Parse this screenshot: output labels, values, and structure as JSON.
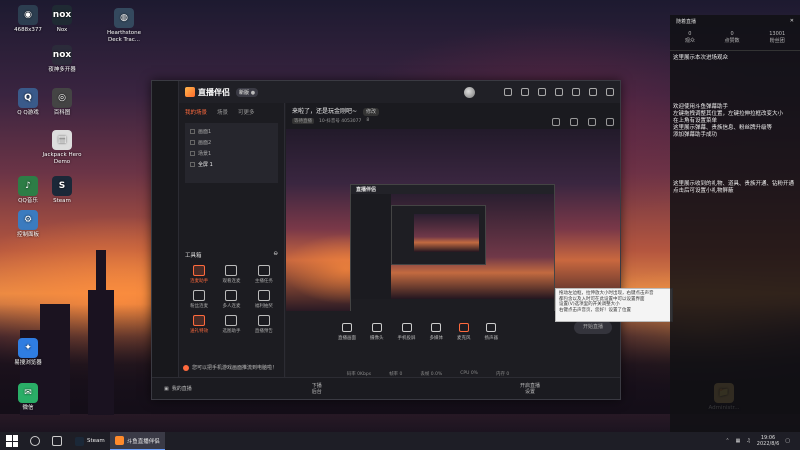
{
  "desktop_icons": [
    {
      "label": "4688x377",
      "color": "#2c3e50",
      "glyph": "◉"
    },
    {
      "label": "Nox",
      "color": "#1f2a33",
      "glyph": "nox"
    },
    {
      "label": "Hearthstone Deck Trac...",
      "color": "#34495e",
      "glyph": "◍"
    },
    {
      "label": "夜神多开器",
      "color": "#2b2b3a",
      "glyph": "nox"
    },
    {
      "label": "Q Q游戏",
      "color": "#3a5a8a",
      "glyph": "Q"
    },
    {
      "label": "百科图",
      "color": "#444",
      "glyph": "◎"
    },
    {
      "label": "Jackpack Hero Demo",
      "color": "#ddd",
      "glyph": "▤"
    },
    {
      "label": "QQ音乐",
      "color": "#2d7d46",
      "glyph": "♪"
    },
    {
      "label": "Steam",
      "color": "#1b2838",
      "glyph": "S"
    },
    {
      "label": "控制面板",
      "color": "#3b7bbf",
      "glyph": "⚙"
    },
    {
      "label": "易搜浏览器",
      "color": "#2f7de1",
      "glyph": "✦"
    },
    {
      "label": "微信",
      "color": "#2aae67",
      "glyph": "✉"
    },
    {
      "label": "Administr...",
      "color": "#e8c26a",
      "glyph": "📁"
    }
  ],
  "app": {
    "name": "直播伴侣",
    "version_badge": "新版 ●",
    "tabs": [
      "我的场景",
      "场景",
      "可更多"
    ],
    "sources": [
      "画面1",
      "画面2",
      "场景1",
      "全屏 1"
    ],
    "toolbox_title": "工具箱",
    "tools": [
      "连麦助手",
      "观看连麦",
      "主播任务",
      "粉丝连麦",
      "多人连麦",
      "福利抽奖",
      "送礼特效",
      "选图助手",
      "直播预告"
    ],
    "hint": "您可以把手机游戏画面推流到电脑啦！",
    "stream_title": "来啦了，还是玩金刚吧~",
    "stream_title_badge": "修改",
    "meta": [
      "等待直播",
      "10-抖音号 4053077",
      "8"
    ],
    "controls": [
      "直播画面",
      "摄像头",
      "手机投屏",
      "多媒体",
      "麦克风",
      "扬声器"
    ],
    "go_live": "开始直播",
    "status": [
      "码率 0Kbps",
      "帧率 0",
      "丢帧 0.0%",
      "CPU 0%",
      "内存 0"
    ],
    "bottom_left": "我的直播",
    "bottom_mid": "下播\n后台",
    "bottom_right": "开启直播\n设置"
  },
  "tooltip": {
    "lines": [
      "拖动左边框，拉伸放大小时出现，右键点击声音",
      "都包含以及入时可在此设置中可以设置界面",
      "设置(V)选项里的开关调整大小",
      "右键点击声音页，您好！设置了位置"
    ]
  },
  "right_panel": {
    "title": "随着直播",
    "stat_a": "0",
    "stat_b": "0",
    "stat_c": "13001",
    "stat_labels": [
      "观众",
      "点赞数",
      "粉丝团"
    ],
    "line1": "这里展示本次进场观众",
    "welcome": [
      "欢迎使用斗鱼弹幕助手",
      "左键拖拽调整其位置，左键拉伸拉框改变大小",
      "在上角有设置菜单",
      "这里展示弹幕、贵族信息、粉丝牌升级等",
      "添加弹幕助手成功"
    ],
    "gift": [
      "这里展示收到的礼物、道具、贵族开通、钻粉开通",
      "点击后可设置小礼物屏蔽"
    ]
  },
  "taskbar": {
    "apps": [
      {
        "label": "Steam",
        "color": "#1b2838",
        "active": false
      },
      {
        "label": "斗鱼直播伴侣",
        "color": "#ff8a2b",
        "active": true
      }
    ],
    "time": "19:06",
    "date": "2022/8/6"
  }
}
